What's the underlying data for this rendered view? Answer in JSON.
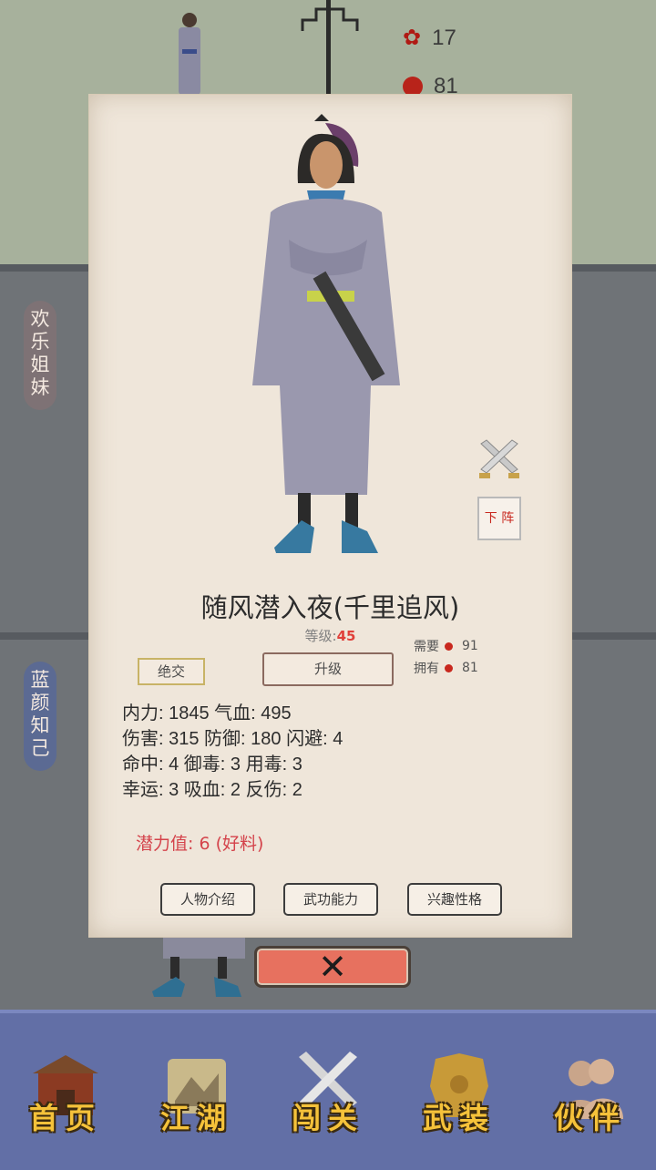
{
  "hud": {
    "roses": "17",
    "pills": "81"
  },
  "side_tags": [
    {
      "label": "欢\n乐\n姐\n妹"
    },
    {
      "label": "蓝\n颜\n知\n己"
    }
  ],
  "dialog": {
    "name": "随风潜入夜(千里追风)",
    "level_label": "等级:",
    "level_value": "45",
    "break_label": "绝交",
    "upgrade_label": "升级",
    "need_label": "需要",
    "need_value": "91",
    "have_label": "拥有",
    "have_value": "81",
    "stats": [
      "内力: 1845 气血: 495",
      "伤害: 315 防御: 180 闪避: 4",
      "命中: 4 御毒: 3 用毒: 3",
      "幸运: 3 吸血: 2 反伤: 2"
    ],
    "potential": "潜力值:  6 (好料)",
    "tabs": [
      "人物介绍",
      "武功能力",
      "兴趣性格"
    ],
    "seal_label": "下 阵",
    "close_label": "✕"
  },
  "nav": [
    {
      "label": "首页",
      "icon": "house-icon"
    },
    {
      "label": "江湖",
      "icon": "scroll-map-icon"
    },
    {
      "label": "闯关",
      "icon": "crossed-swords-icon"
    },
    {
      "label": "武装",
      "icon": "armor-icon"
    },
    {
      "label": "伙伴",
      "icon": "partners-icon"
    }
  ],
  "colors": {
    "accent_red": "#e0403a",
    "nav_bg": "#626fa6",
    "nav_text": "#f5c23a",
    "paper": "#efe6da"
  }
}
